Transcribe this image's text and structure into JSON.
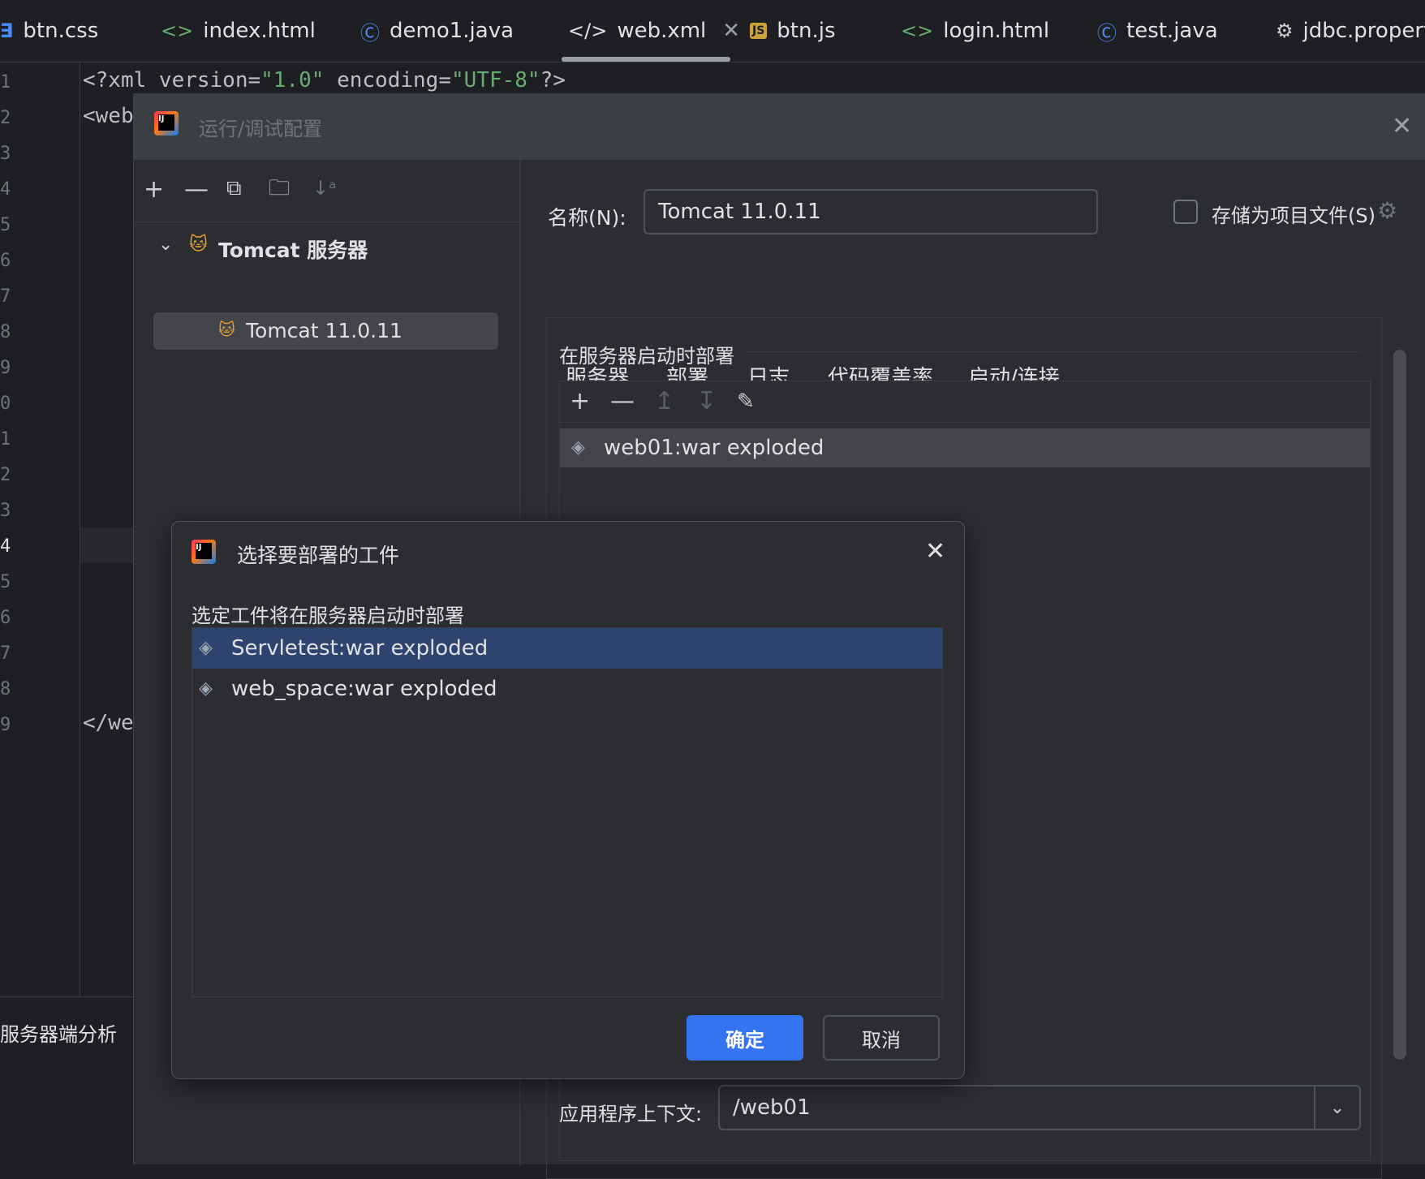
{
  "tabs": [
    {
      "label": "btn.css",
      "icon": "css-file-icon"
    },
    {
      "label": "index.html",
      "icon": "html-file-icon"
    },
    {
      "label": "demo1.java",
      "icon": "java-class-icon"
    },
    {
      "label": "web.xml",
      "icon": "xml-file-icon",
      "active": true
    },
    {
      "label": "btn.js",
      "icon": "js-file-icon"
    },
    {
      "label": "login.html",
      "icon": "html-file-icon"
    },
    {
      "label": "test.java",
      "icon": "java-class-icon"
    },
    {
      "label": "jdbc.propert",
      "icon": "gear-icon"
    }
  ],
  "editor": {
    "line_numbers": [
      "1",
      "2",
      "3",
      "4",
      "5",
      "6",
      "7",
      "8",
      "9",
      "0",
      "1",
      "2",
      "3",
      "4",
      "5",
      "6",
      "7",
      "8",
      "9"
    ],
    "line1": {
      "a": "<?xml version=",
      "b": "\"1.0\"",
      "c": " encoding=",
      "d": "\"UTF-8\"",
      "e": "?>"
    },
    "line2": "<web",
    "line19": "</we"
  },
  "bottom_panel": {
    "label": "服务器端分析"
  },
  "run_config": {
    "title": "运行/调试配置",
    "tree": {
      "group": "Tomcat 服务器",
      "item": "Tomcat 11.0.11"
    },
    "name_label": "名称(N):",
    "name_value": "Tomcat 11.0.11",
    "store_label": "存储为项目文件(S)",
    "tabs": [
      "服务器",
      "部署",
      "日志",
      "代码覆盖率",
      "启动/连接"
    ],
    "active_tab": "部署",
    "deploy_section_title": "在服务器启动时部署",
    "deploy_items": [
      "web01:war exploded"
    ],
    "context_label": "应用程序上下文:",
    "context_value": "/web01"
  },
  "modal": {
    "title": "选择要部署的工件",
    "subtitle": "选定工件将在服务器启动时部署",
    "items": [
      {
        "label": "Servletest:war exploded",
        "selected": true
      },
      {
        "label": "web_space:war exploded",
        "selected": false
      }
    ],
    "ok_label": "确定",
    "cancel_label": "取消"
  },
  "colors": {
    "accent": "#3574f0",
    "selection": "#2e436e",
    "background": "#2b2d30"
  }
}
